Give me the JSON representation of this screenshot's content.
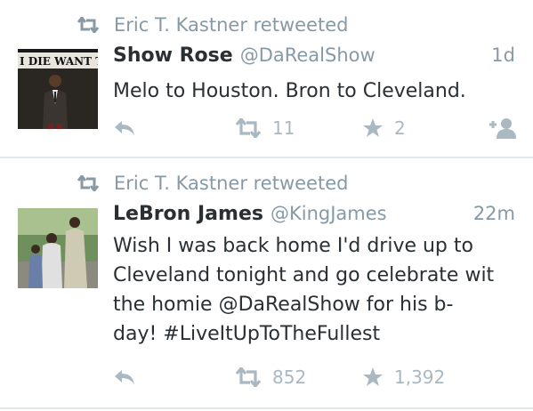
{
  "colors": {
    "muted": "#8899a6",
    "action": "#aab8c2",
    "text": "#292f33",
    "divider": "#e1e8ed"
  },
  "tweets": [
    {
      "retweeted_by": "Eric T. Kastner retweeted",
      "avatar_banner": "I DIE WANT T",
      "name": "Show Rose",
      "handle": "@DaRealShow",
      "time": "1d",
      "lines": [
        "Melo to Houston. Bron to Cleveland."
      ],
      "retweets": "11",
      "favorites": "2",
      "icons": {
        "reply": "reply-icon",
        "retweet": "retweet-icon",
        "favorite": "star-icon",
        "follow": "follow-user-icon"
      }
    },
    {
      "retweeted_by": "Eric T. Kastner retweeted",
      "name": "LeBron James",
      "handle": "@KingJames",
      "time": "22m",
      "lines": [
        "Wish I was back home I'd drive up to",
        "Cleveland tonight and go celebrate wit",
        "the homie @DaRealShow for his b-",
        "day! #LiveItUpToTheFullest"
      ],
      "retweets": "852",
      "favorites": "1,392",
      "icons": {
        "reply": "reply-icon",
        "retweet": "retweet-icon",
        "favorite": "star-icon"
      }
    }
  ]
}
